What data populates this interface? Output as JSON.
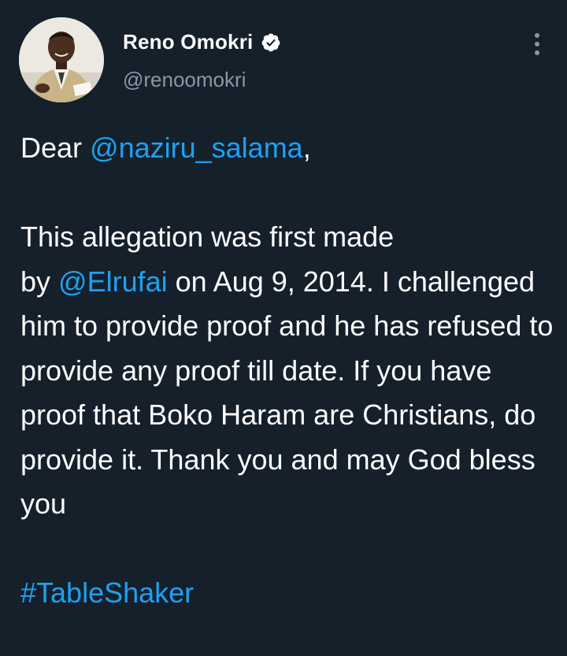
{
  "author": {
    "display_name": "Reno Omokri",
    "handle": "@renoomokri",
    "verified": true,
    "avatar_icon": "profile-photo"
  },
  "tweet": {
    "greeting_prefix": "Dear ",
    "greeting_mention": "@naziru_salama",
    "greeting_suffix": ",",
    "para_line1": "This allegation was first made",
    "para_by": "by ",
    "para_mention": "@Elrufai",
    "para_rest": " on Aug 9, 2014. I challenged him to provide proof and he has refused to provide any proof till date. If you have proof that Boko Haram are Christians, do provide it. Thank you and may God bless you",
    "hashtag": "#TableShaker"
  },
  "colors": {
    "background": "#15202b",
    "link": "#1da1f2",
    "secondary_text": "#8899a6"
  }
}
